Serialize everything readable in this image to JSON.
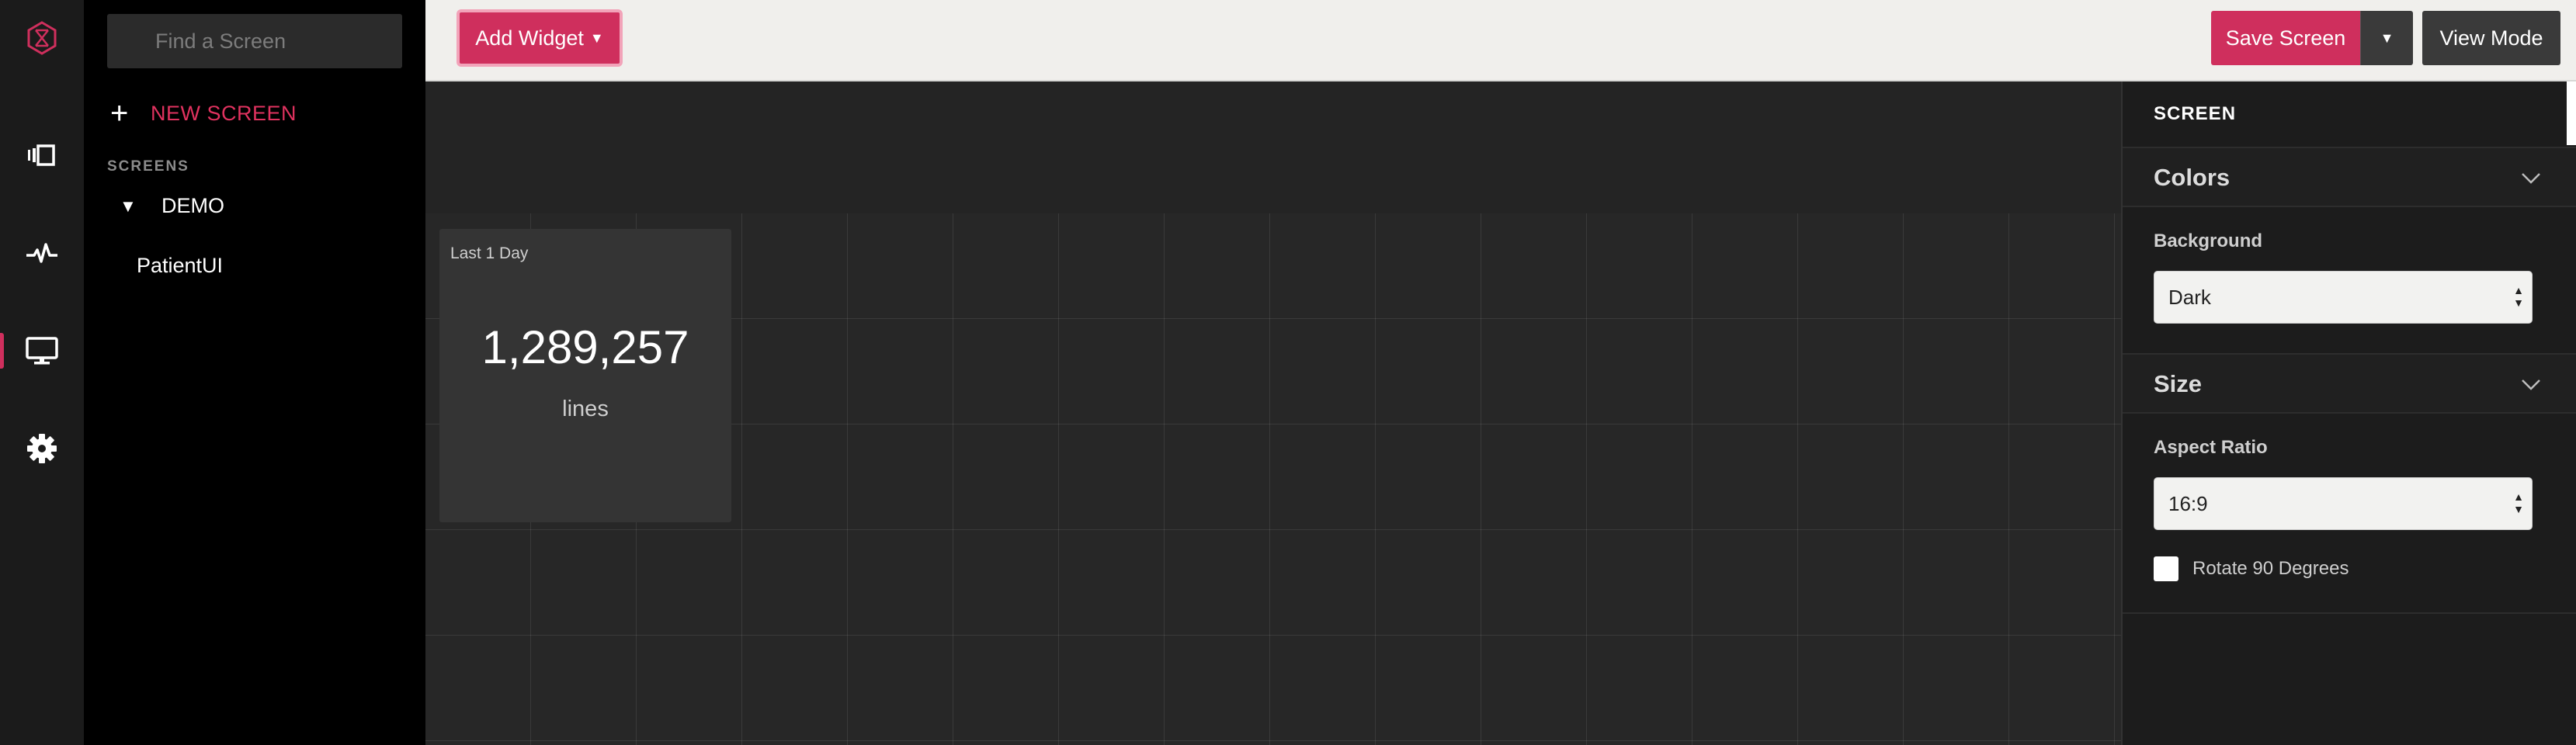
{
  "app": {
    "brand_color": "#cf2f5d"
  },
  "rail": {
    "items": [
      {
        "icon": "logo-icon"
      },
      {
        "icon": "screens-carousel-icon"
      },
      {
        "icon": "activity-pulse-icon"
      },
      {
        "icon": "monitor-icon",
        "active": true
      },
      {
        "icon": "gear-icon"
      }
    ]
  },
  "sidebar": {
    "search_placeholder": "Find a Screen",
    "new_screen_label": "NEW SCREEN",
    "section_label": "SCREENS",
    "tree": {
      "label": "DEMO",
      "expanded": true,
      "children": [
        "PatientUI"
      ]
    }
  },
  "toolbar": {
    "add_widget_label": "Add Widget",
    "save_label": "Save Screen",
    "view_mode_label": "View Mode"
  },
  "widget": {
    "title": "Last 1 Day",
    "value": "1,289,257",
    "unit": "lines"
  },
  "panel": {
    "header": "SCREEN",
    "colors": {
      "title": "Colors",
      "background_label": "Background",
      "background_value": "Dark"
    },
    "size": {
      "title": "Size",
      "aspect_label": "Aspect Ratio",
      "aspect_value": "16:9",
      "rotate_label": "Rotate 90 Degrees",
      "rotate_checked": false
    }
  }
}
